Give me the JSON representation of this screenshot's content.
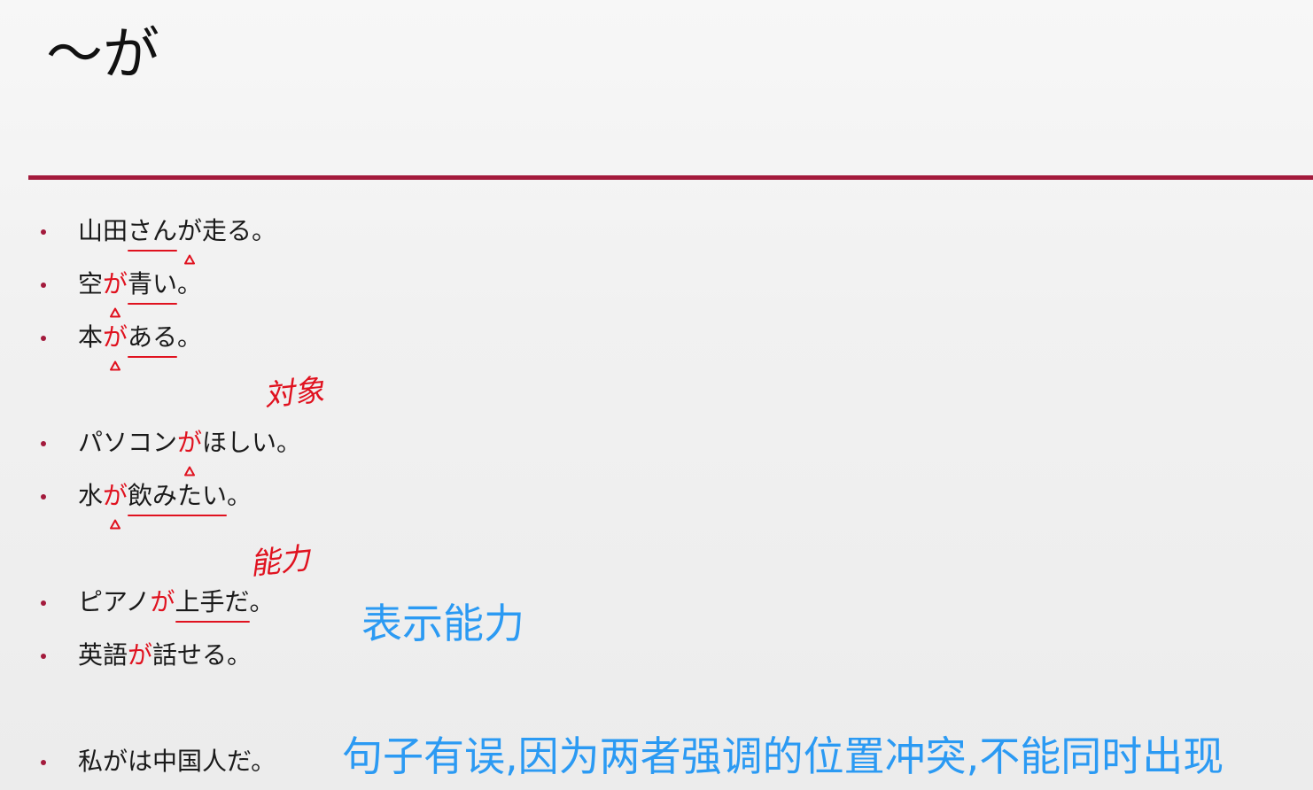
{
  "slide": {
    "title": "～が",
    "handnotes": [
      "対象",
      "能力"
    ],
    "notes": {
      "ability": "表示能力",
      "error": "句子有误,因为两者强调的位置冲突,不能同时出现"
    },
    "accent_color": "#a31a3c",
    "annotation_red": "#e0121f",
    "note_blue": "#2b9af3",
    "examples": [
      [
        {
          "t": "山田"
        },
        {
          "t": "さん",
          "ul": true
        },
        {
          "t": "が",
          "tri": true
        },
        {
          "t": "走る。"
        }
      ],
      [
        {
          "t": "空"
        },
        {
          "t": "が",
          "red": true,
          "tri": true
        },
        {
          "t": "青い",
          "ul": true
        },
        {
          "t": "。"
        }
      ],
      [
        {
          "t": "本"
        },
        {
          "t": "が",
          "red": true,
          "tri": true
        },
        {
          "t": "ある",
          "ul": true
        },
        {
          "t": "。"
        }
      ],
      [
        {
          "t": "パソコン"
        },
        {
          "t": "が",
          "red": true,
          "tri": true
        },
        {
          "t": "ほしい。"
        }
      ],
      [
        {
          "t": "水"
        },
        {
          "t": "が",
          "red": true,
          "tri": true
        },
        {
          "t": "飲みたい",
          "ul": true
        },
        {
          "t": "。"
        }
      ],
      [
        {
          "t": "ピアノ"
        },
        {
          "t": "が",
          "red": true
        },
        {
          "t": "上手だ",
          "ul": true
        },
        {
          "t": "。"
        }
      ],
      [
        {
          "t": "英語"
        },
        {
          "t": "が",
          "red": true
        },
        {
          "t": "話せる。"
        }
      ],
      [
        {
          "t": "私がは中国人だ。"
        }
      ]
    ]
  }
}
